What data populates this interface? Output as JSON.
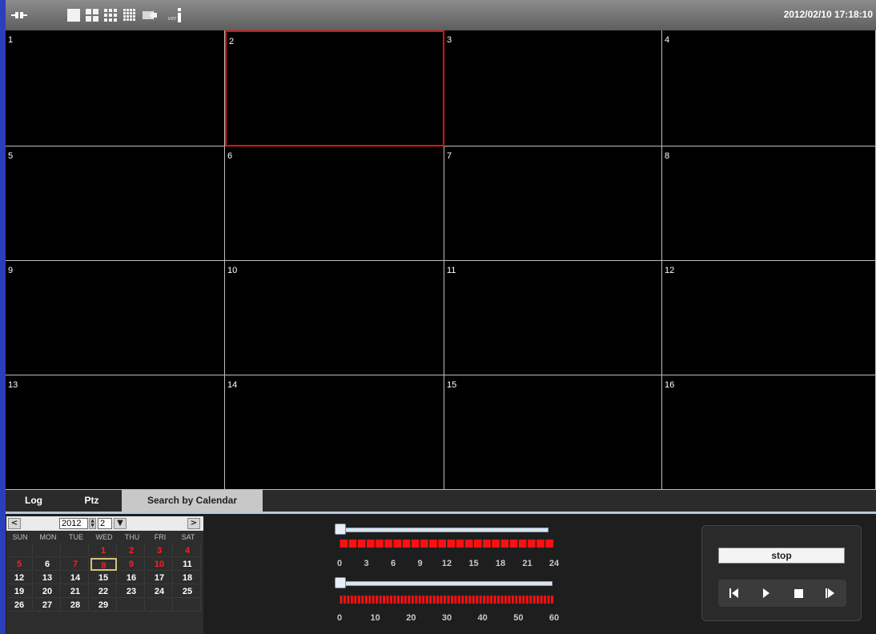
{
  "topbar": {
    "datetime": "2012/02/10 17:18:10",
    "icons": [
      "connection-icon",
      "layout-1x1-icon",
      "layout-2x2-icon",
      "layout-3x3-icon",
      "layout-4x4-icon",
      "export-icon",
      "info-icon"
    ],
    "ver_label": "ver"
  },
  "channels": [
    "1",
    "2",
    "3",
    "4",
    "5",
    "6",
    "7",
    "8",
    "9",
    "10",
    "11",
    "12",
    "13",
    "14",
    "15",
    "16"
  ],
  "selected_channel": "2",
  "tabs": [
    {
      "label": "Log"
    },
    {
      "label": "Ptz"
    },
    {
      "label": "Search by Calendar"
    }
  ],
  "calendar": {
    "year": "2012",
    "month": "2",
    "prev": "<",
    "next": ">",
    "weekdays": [
      "SUN",
      "MON",
      "TUE",
      "WED",
      "THU",
      "FRI",
      "SAT"
    ],
    "weeks": [
      [
        "",
        "",
        "",
        "1",
        "2",
        "3",
        "4"
      ],
      [
        "5",
        "6",
        "7",
        "8",
        "9",
        "10",
        "11"
      ],
      [
        "12",
        "13",
        "14",
        "15",
        "16",
        "17",
        "18"
      ],
      [
        "19",
        "20",
        "21",
        "22",
        "23",
        "24",
        "25"
      ],
      [
        "26",
        "27",
        "28",
        "29",
        "",
        "",
        ""
      ]
    ],
    "recorded_days": [
      "1",
      "2",
      "3",
      "4",
      "5",
      "7",
      "8",
      "9",
      "10"
    ],
    "selected_day": "8"
  },
  "hour_scale": [
    "0",
    "3",
    "6",
    "9",
    "12",
    "15",
    "18",
    "21",
    "24"
  ],
  "minute_scale": [
    "0",
    "10",
    "20",
    "30",
    "40",
    "50",
    "60"
  ],
  "playback": {
    "status": "stop",
    "buttons": [
      "prev-frame",
      "play",
      "stop",
      "next-frame"
    ]
  },
  "colors": {
    "selected_border": "#e01010",
    "record_red": "#ff1010",
    "sidebar_blue": "#2a3fbd"
  }
}
